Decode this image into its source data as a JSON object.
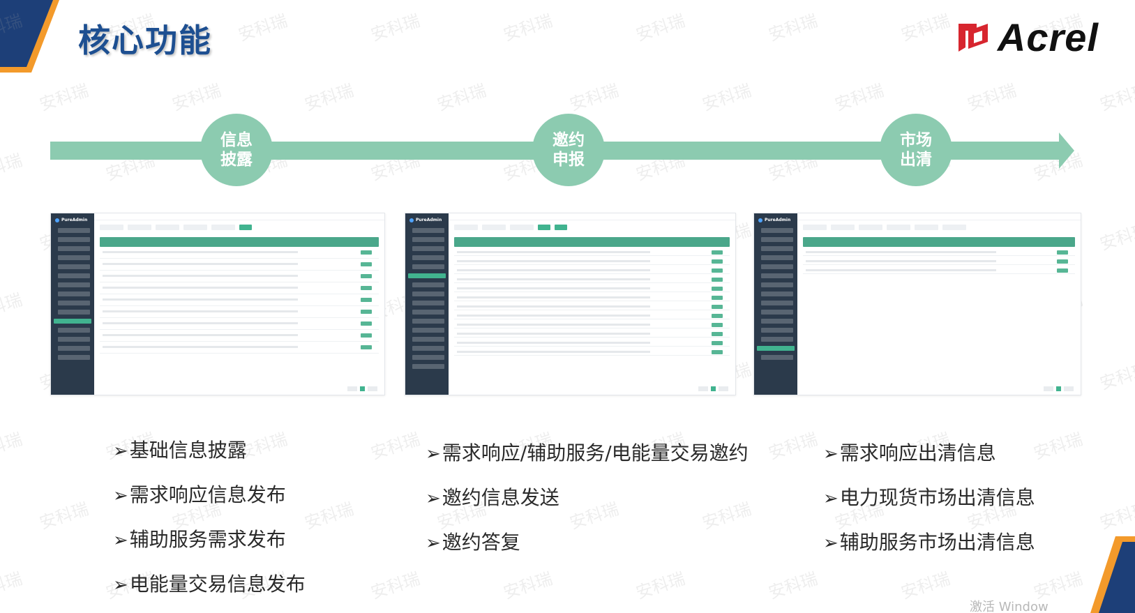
{
  "slide": {
    "title": "核心功能",
    "logo_text": "Acrel",
    "colors": {
      "title": "#1d4f91",
      "arrow": "#8ccbb0",
      "accent_orange": "#f39a2b",
      "accent_navy": "#1d3f78",
      "logo_red": "#d7262f"
    }
  },
  "watermark": {
    "text": "安科瑞"
  },
  "stages": [
    {
      "label": "信息\n披露"
    },
    {
      "label": "邀约\n申报"
    },
    {
      "label": "市场\n出清"
    }
  ],
  "screenshots": [
    {
      "app_name": "PureAdmin"
    },
    {
      "app_name": "PureAdmin"
    },
    {
      "app_name": "PureAdmin"
    }
  ],
  "bullet_marker": "➢",
  "bullets": {
    "col1": [
      "基础信息披露",
      "需求响应信息发布",
      "辅助服务需求发布",
      "电能量交易信息发布"
    ],
    "col2": [
      "需求响应/辅助服务/电能量交易邀约",
      "邀约信息发送",
      "邀约答复"
    ],
    "col3": [
      "需求响应出清信息",
      "电力现货市场出清信息",
      "辅助服务市场出清信息"
    ]
  },
  "os_overlay": {
    "text": "激活 Window"
  }
}
